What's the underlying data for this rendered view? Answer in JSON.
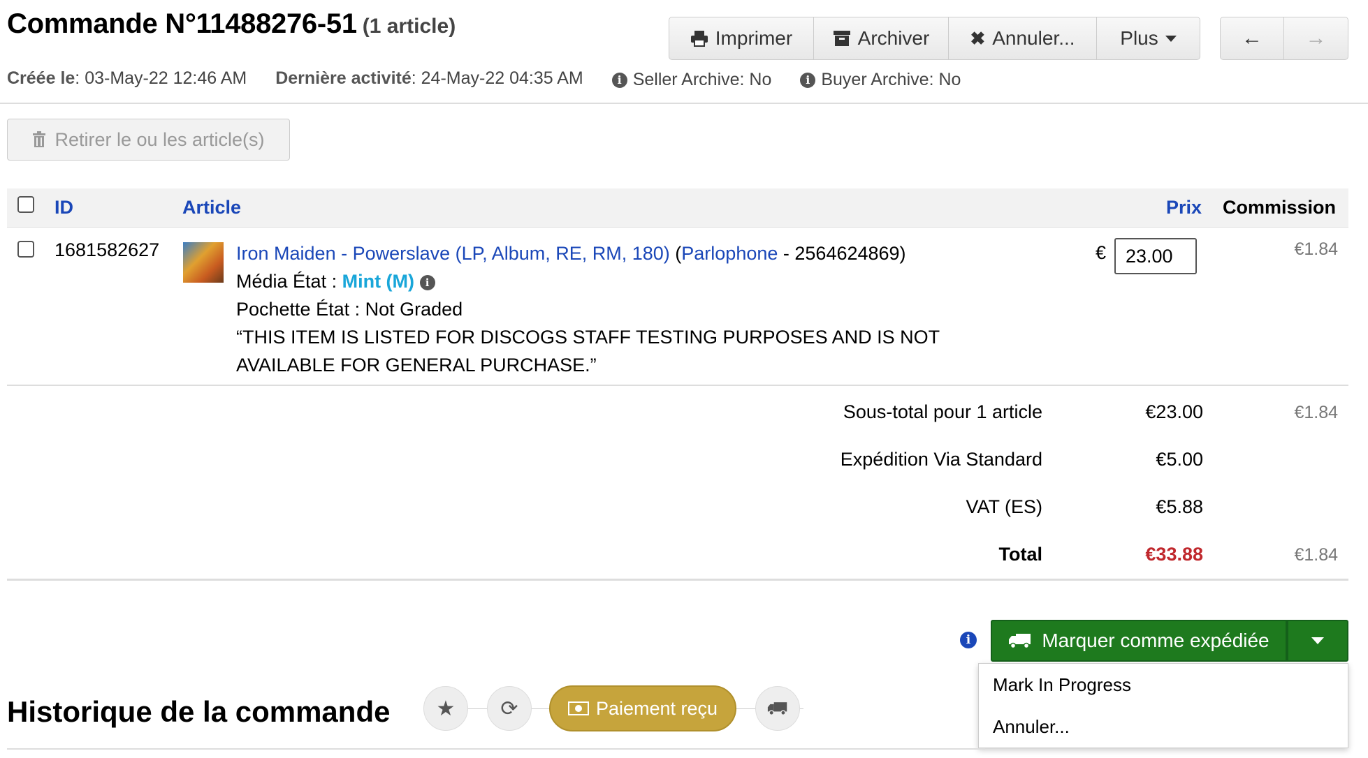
{
  "order": {
    "title": "Commande N°11488276-51",
    "count": "(1 article)",
    "created_label": "Créée le",
    "created_value": ": 03-May-22 12:46 AM",
    "activity_label": "Dernière activité",
    "activity_value": ": 24-May-22 04:35 AM",
    "seller_archive": "Seller Archive: No",
    "buyer_archive": "Buyer Archive: No"
  },
  "toolbar": {
    "print": "Imprimer",
    "archive": "Archiver",
    "cancel": "Annuler...",
    "more": "Plus",
    "prev": "←",
    "next": "→"
  },
  "remove_button": "Retirer le ou les article(s)",
  "table": {
    "headers": {
      "id": "ID",
      "article": "Article",
      "price": "Prix",
      "commission": "Commission"
    },
    "item": {
      "id": "1681582627",
      "title": "Iron Maiden - Powerslave (LP, Album, RE, RM, 180)",
      "label_open": "(",
      "label": "Parlophone",
      "label_close": " - 2564624869)",
      "media_label": "Média État : ",
      "media_value": "Mint (M)",
      "sleeve": "Pochette État : Not Graded",
      "comment_line1": "“THIS ITEM IS LISTED FOR DISCOGS STAFF TESTING PURPOSES AND IS NOT",
      "comment_line2": "AVAILABLE FOR GENERAL PURCHASE.”",
      "currency": "€",
      "price": "23.00",
      "commission": "€1.84"
    }
  },
  "summary": {
    "subtotal_label": "Sous-total pour 1 article",
    "subtotal_value": "€23.00",
    "subtotal_commission": "€1.84",
    "shipping_label": "Expédition Via Standard",
    "shipping_value": "€5.00",
    "vat_label": "VAT (ES)",
    "vat_value": "€5.88",
    "total_label": "Total",
    "total_value": "€33.88",
    "total_commission": "€1.84"
  },
  "actions": {
    "ship_button": "Marquer comme expédiée",
    "menu": [
      "Mark In Progress",
      "Annuler..."
    ]
  },
  "history": {
    "title": "Historique de la commande",
    "payment_received": "Paiement reçu"
  },
  "colors": {
    "ship_green": "#1e7a1e",
    "link_blue": "#1a47b8",
    "mint": "#19a6d9",
    "total_red": "#c0282d",
    "paid_gold": "#c6a43c"
  }
}
